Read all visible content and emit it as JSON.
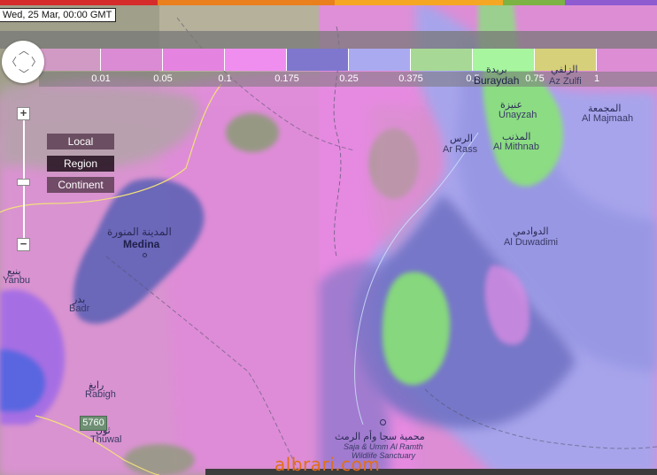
{
  "date_label": "Wed, 25 Mar, 00:00 GMT",
  "top_bar_colors": [
    "#d62b2b",
    "#ea7f1e",
    "#f5a623",
    "#7cb342",
    "#8e5bd0"
  ],
  "legend": {
    "swatch_colors": [
      "#d19ac5",
      "#db8bd3",
      "#e583e1",
      "#f08ef0",
      "#7f77cd",
      "#aaaaf0",
      "#a8d896",
      "#a7f59e",
      "#d6d07a"
    ],
    "labels": [
      "0.01",
      "0.05",
      "0.1",
      "0.175",
      "0.25",
      "0.375",
      "0.5",
      "0.75",
      "1"
    ]
  },
  "controls": {
    "zoom_in": "+",
    "zoom_out": "−",
    "zoom_mid": "−",
    "scale_buttons": [
      {
        "label": "Local",
        "active": false
      },
      {
        "label": "Region",
        "active": true
      },
      {
        "label": "Continent",
        "active": false
      }
    ]
  },
  "places": {
    "buraydah_ar": "بريدة",
    "buraydah": "Buraydah",
    "az_zulfi_ar": "الزلفي",
    "az_zulfi": "Az Zulfi",
    "unayzah_ar": "عنيزة",
    "unayzah": "Unayzah",
    "al_majmaah_ar": "المجمعة",
    "al_majmaah": "Al Majmaah",
    "ar_rass_ar": "الرس",
    "ar_rass": "Ar Rass",
    "al_mithnab_ar": "المذنب",
    "al_mithnab": "Al Mithnab",
    "al_duwadimi_ar": "الدوادمي",
    "al_duwadimi": "Al Duwadimi",
    "medina_ar": "المدينة المنورة",
    "medina": "Medina",
    "yanbu_ar": "ينبع",
    "yanbu": "Yanbu",
    "badr_ar": "بدر",
    "badr": "Badr",
    "rabigh_ar": "رابغ",
    "rabigh": "Rabigh",
    "thuwal_ar": "ثول",
    "thuwal": "Thuwal",
    "sanctuary_ar": "محمية سجا وأم الرمث",
    "sanctuary_1": "Saja & Umm Al Ramth",
    "sanctuary_2": "Wildlife Sanctuary"
  },
  "road_badge": "5760",
  "watermark": "albrari.com"
}
